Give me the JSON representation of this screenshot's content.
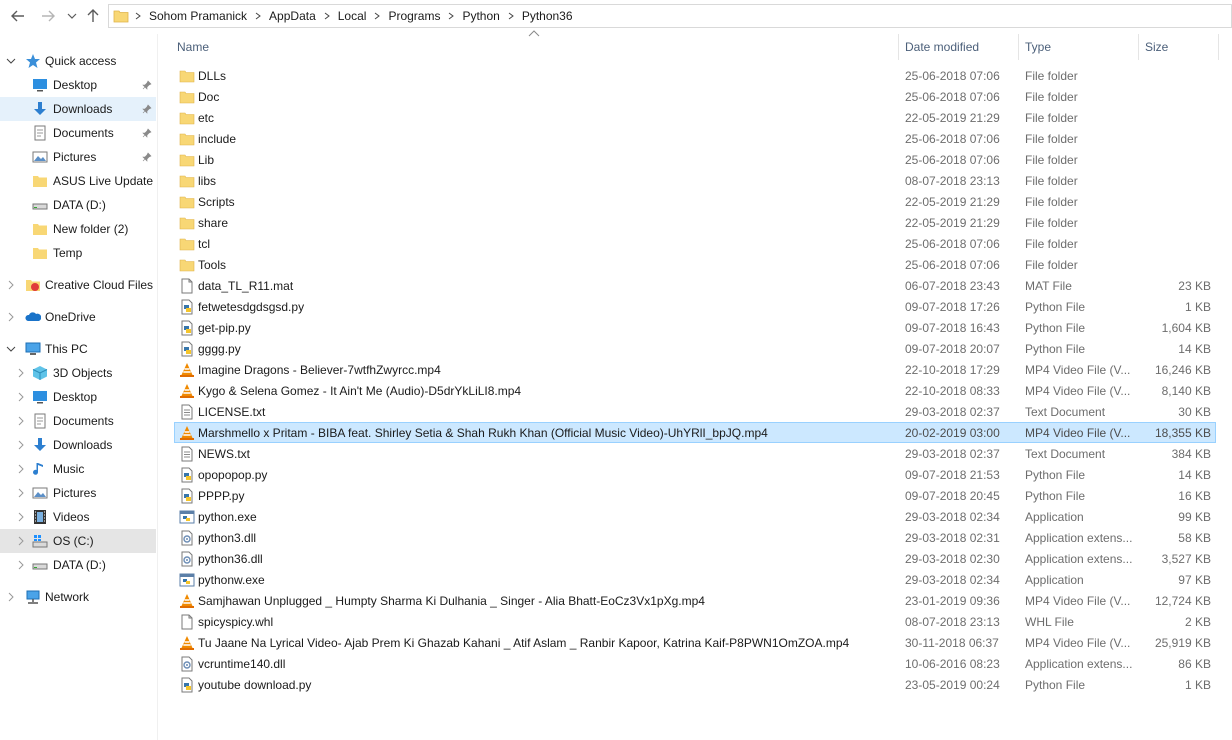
{
  "address": {
    "crumbs": [
      "Sohom Pramanick",
      "AppData",
      "Local",
      "Programs",
      "Python",
      "Python36"
    ]
  },
  "nav": {
    "quick_access": "Quick access",
    "desktop": "Desktop",
    "downloads": "Downloads",
    "documents": "Documents",
    "pictures": "Pictures",
    "asus": "ASUS Live Update",
    "data_d": "DATA (D:)",
    "new_folder": "New folder (2)",
    "temp": "Temp",
    "creative_cloud": "Creative Cloud Files",
    "onedrive": "OneDrive",
    "this_pc": "This PC",
    "objects3d": "3D Objects",
    "pc_desktop": "Desktop",
    "pc_documents": "Documents",
    "pc_downloads": "Downloads",
    "music": "Music",
    "pc_pictures": "Pictures",
    "videos": "Videos",
    "os_c": "OS (C:)",
    "pc_data_d": "DATA (D:)",
    "network": "Network"
  },
  "columns": {
    "name": "Name",
    "date": "Date modified",
    "type": "Type",
    "size": "Size"
  },
  "files": [
    {
      "name": "DLLs",
      "date": "25-06-2018 07:06",
      "type": "File folder",
      "size": "",
      "icon": "folder"
    },
    {
      "name": "Doc",
      "date": "25-06-2018 07:06",
      "type": "File folder",
      "size": "",
      "icon": "folder"
    },
    {
      "name": "etc",
      "date": "22-05-2019 21:29",
      "type": "File folder",
      "size": "",
      "icon": "folder"
    },
    {
      "name": "include",
      "date": "25-06-2018 07:06",
      "type": "File folder",
      "size": "",
      "icon": "folder"
    },
    {
      "name": "Lib",
      "date": "25-06-2018 07:06",
      "type": "File folder",
      "size": "",
      "icon": "folder"
    },
    {
      "name": "libs",
      "date": "08-07-2018 23:13",
      "type": "File folder",
      "size": "",
      "icon": "folder"
    },
    {
      "name": "Scripts",
      "date": "22-05-2019 21:29",
      "type": "File folder",
      "size": "",
      "icon": "folder"
    },
    {
      "name": "share",
      "date": "22-05-2019 21:29",
      "type": "File folder",
      "size": "",
      "icon": "folder"
    },
    {
      "name": "tcl",
      "date": "25-06-2018 07:06",
      "type": "File folder",
      "size": "",
      "icon": "folder"
    },
    {
      "name": "Tools",
      "date": "25-06-2018 07:06",
      "type": "File folder",
      "size": "",
      "icon": "folder"
    },
    {
      "name": "data_TL_R11.mat",
      "date": "06-07-2018 23:43",
      "type": "MAT File",
      "size": "23 KB",
      "icon": "doc"
    },
    {
      "name": "fetwetesdgdsgsd.py",
      "date": "09-07-2018 17:26",
      "type": "Python File",
      "size": "1 KB",
      "icon": "py"
    },
    {
      "name": "get-pip.py",
      "date": "09-07-2018 16:43",
      "type": "Python File",
      "size": "1,604 KB",
      "icon": "py"
    },
    {
      "name": "gggg.py",
      "date": "09-07-2018 20:07",
      "type": "Python File",
      "size": "14 KB",
      "icon": "py"
    },
    {
      "name": "Imagine Dragons - Believer-7wtfhZwyrcc.mp4",
      "date": "22-10-2018 17:29",
      "type": "MP4 Video File (V...",
      "size": "16,246 KB",
      "icon": "vlc"
    },
    {
      "name": "Kygo & Selena Gomez - It Ain't Me (Audio)-D5drYkLiLI8.mp4",
      "date": "22-10-2018 08:33",
      "type": "MP4 Video File (V...",
      "size": "8,140 KB",
      "icon": "vlc"
    },
    {
      "name": "LICENSE.txt",
      "date": "29-03-2018 02:37",
      "type": "Text Document",
      "size": "30 KB",
      "icon": "txt"
    },
    {
      "name": "Marshmello x Pritam - BIBA feat. Shirley Setia & Shah Rukh Khan (Official Music Video)-UhYRlI_bpJQ.mp4",
      "date": "20-02-2019 03:00",
      "type": "MP4 Video File (V...",
      "size": "18,355 KB",
      "icon": "vlc",
      "selected": true
    },
    {
      "name": "NEWS.txt",
      "date": "29-03-2018 02:37",
      "type": "Text Document",
      "size": "384 KB",
      "icon": "txt"
    },
    {
      "name": "opopopop.py",
      "date": "09-07-2018 21:53",
      "type": "Python File",
      "size": "14 KB",
      "icon": "py"
    },
    {
      "name": "PPPP.py",
      "date": "09-07-2018 20:45",
      "type": "Python File",
      "size": "16 KB",
      "icon": "py"
    },
    {
      "name": "python.exe",
      "date": "29-03-2018 02:34",
      "type": "Application",
      "size": "99 KB",
      "icon": "exe"
    },
    {
      "name": "python3.dll",
      "date": "29-03-2018 02:31",
      "type": "Application extens...",
      "size": "58 KB",
      "icon": "dll"
    },
    {
      "name": "python36.dll",
      "date": "29-03-2018 02:30",
      "type": "Application extens...",
      "size": "3,527 KB",
      "icon": "dll"
    },
    {
      "name": "pythonw.exe",
      "date": "29-03-2018 02:34",
      "type": "Application",
      "size": "97 KB",
      "icon": "exe"
    },
    {
      "name": "Samjhawan Unplugged _ Humpty Sharma Ki Dulhania _ Singer - Alia Bhatt-EoCz3Vx1pXg.mp4",
      "date": "23-01-2019 09:36",
      "type": "MP4 Video File (V...",
      "size": "12,724 KB",
      "icon": "vlc"
    },
    {
      "name": "spicyspicy.whl",
      "date": "08-07-2018 23:13",
      "type": "WHL File",
      "size": "2 KB",
      "icon": "doc"
    },
    {
      "name": "Tu Jaane Na Lyrical Video- Ajab Prem Ki Ghazab Kahani _ Atif Aslam _ Ranbir Kapoor, Katrina Kaif-P8PWN1OmZOA.mp4",
      "date": "30-11-2018 06:37",
      "type": "MP4 Video File (V...",
      "size": "25,919 KB",
      "icon": "vlc"
    },
    {
      "name": "vcruntime140.dll",
      "date": "10-06-2016 08:23",
      "type": "Application extens...",
      "size": "86 KB",
      "icon": "dll"
    },
    {
      "name": "youtube download.py",
      "date": "23-05-2019 00:24",
      "type": "Python File",
      "size": "1 KB",
      "icon": "py"
    }
  ]
}
